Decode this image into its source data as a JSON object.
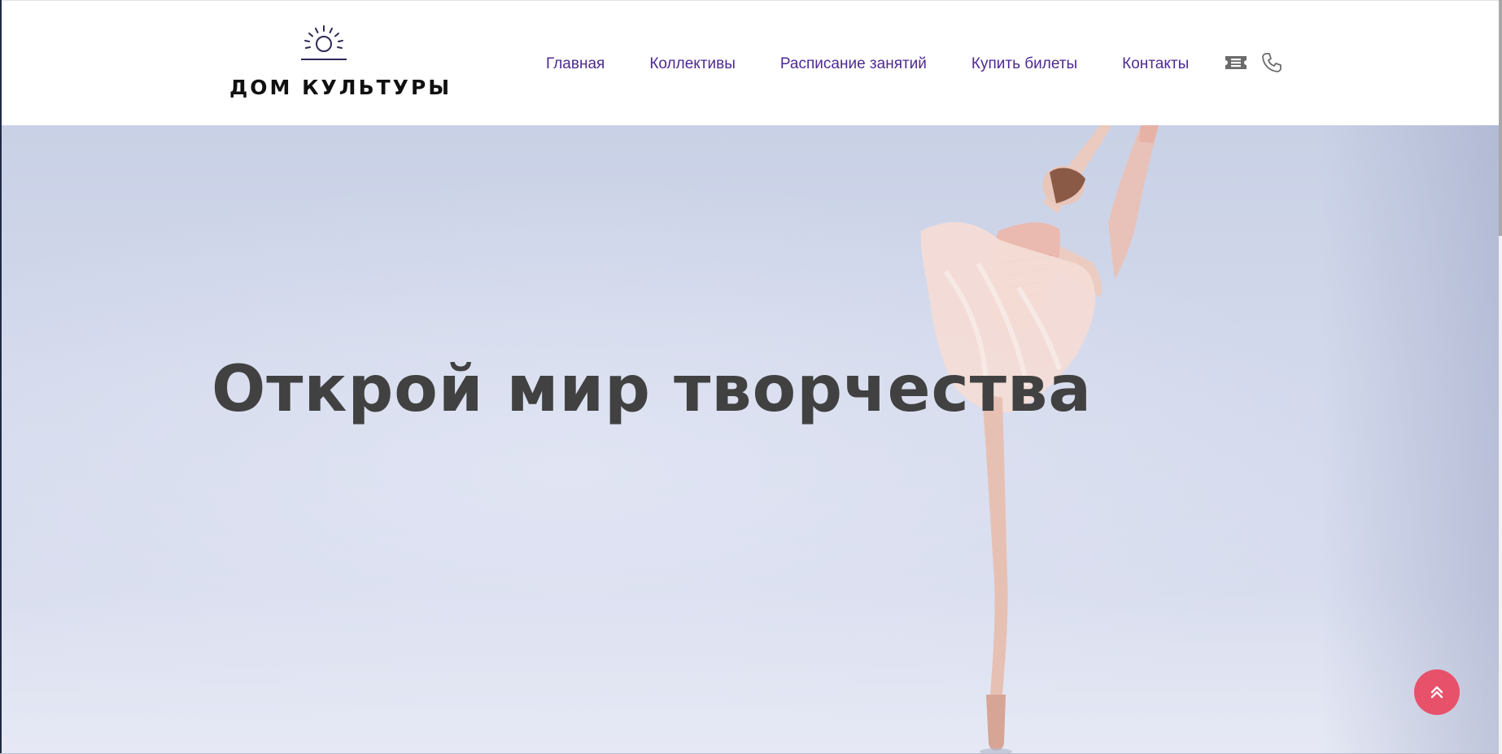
{
  "header": {
    "logo": {
      "text": "ДОМ КУЛЬТУРЫ",
      "icon": "sun-icon"
    },
    "nav": [
      {
        "label": "Главная"
      },
      {
        "label": "Коллективы"
      },
      {
        "label": "Расписание занятий"
      },
      {
        "label": "Купить билеты"
      },
      {
        "label": "Контакты"
      }
    ],
    "icons": [
      "ticket-icon",
      "phone-icon"
    ]
  },
  "hero": {
    "title": "Открой мир творчества",
    "image": "ballerina-photo"
  },
  "scroll_top": {
    "icon": "double-chevron-up-icon"
  },
  "colors": {
    "nav_text": "#4e2a91",
    "hero_title": "#414141",
    "scroll_top_bg": "#e8516a",
    "hero_bg": "#d3d9ec"
  }
}
